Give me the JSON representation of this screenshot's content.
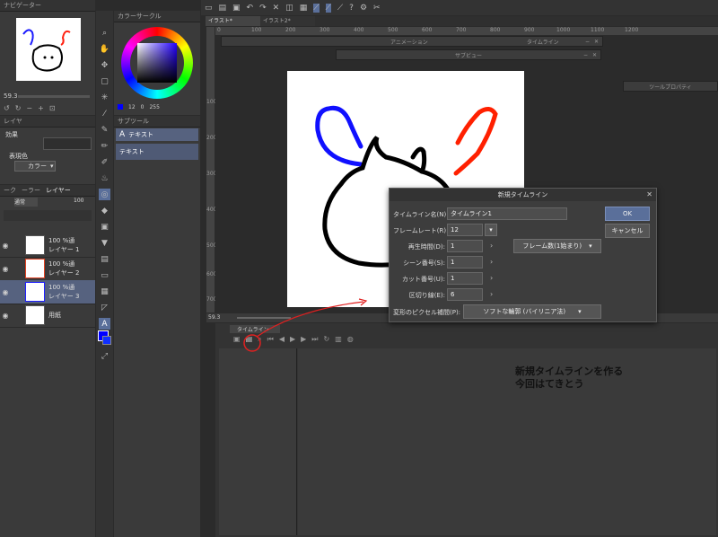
{
  "navigator": {
    "title": "ナビゲーター",
    "zoom": "59.3"
  },
  "colorpanel": {
    "title": "カラーサークル",
    "v1": "12",
    "v2": "0",
    "v3": "255"
  },
  "subtool": {
    "title": "サブツール",
    "items": [
      "テキスト",
      "テキスト"
    ]
  },
  "layerprop": {
    "tab": "レイヤ",
    "effect": "効果",
    "expression": "表現色",
    "color_mode": "カラー"
  },
  "layers": {
    "tabs": [
      "ーク",
      "ーラー",
      "レイヤー"
    ],
    "blend": "通常",
    "opacity": "100",
    "items": [
      {
        "info1": "100 %通",
        "info2": "レイヤー 1"
      },
      {
        "info1": "100 %通",
        "info2": "レイヤー 2"
      },
      {
        "info1": "100 %通",
        "info2": "レイヤー 3"
      },
      {
        "info1": "",
        "info2": "用紙"
      }
    ]
  },
  "tabs": [
    "イラスト*",
    "イラスト2*"
  ],
  "ruler": [
    "0",
    "100",
    "200",
    "300",
    "400",
    "500",
    "600",
    "700",
    "800",
    "900",
    "1000",
    "1100",
    "1200"
  ],
  "vruler": [
    "100",
    "200",
    "300",
    "400",
    "500",
    "600",
    "700"
  ],
  "floating": [
    "アニメーション",
    "タイムライン",
    "サブビュー",
    "ツールプロパティ"
  ],
  "canvas": {
    "zoom": "59.3"
  },
  "timeline": {
    "title": "タイムライン"
  },
  "dialog": {
    "title": "新規タイムライン",
    "name_label": "タイムライン名(N):",
    "name_value": "タイムライン1",
    "fps_label": "フレームレート(R):",
    "fps_value": "12",
    "playtime_label": "再生時間(D):",
    "playtime_value": "1",
    "playtime_option": "フレーム数(1始まり)",
    "scene_label": "シーン番号(S):",
    "scene_value": "1",
    "cut_label": "カット番号(U):",
    "cut_value": "1",
    "divider_label": "区切り線(E):",
    "divider_value": "6",
    "interp_label": "変形のピクセル補間(P):",
    "interp_value": "ソフトな輪郭 (バイリニア法)",
    "ok": "OK",
    "cancel": "キャンセル"
  },
  "annotation": {
    "line1": "新規タイムラインを作る",
    "line2": "今回はてきとう"
  },
  "colors": {
    "accent": "#5a6f9a",
    "annotation": "#e02020"
  }
}
